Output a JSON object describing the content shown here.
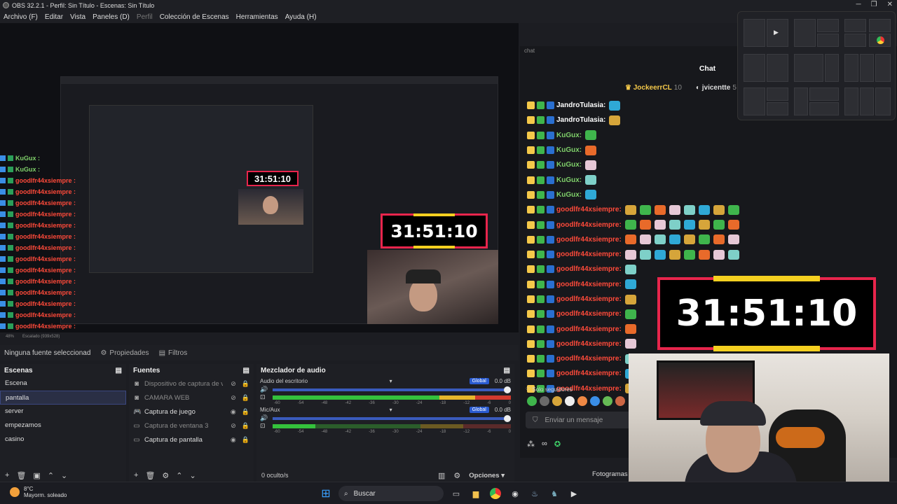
{
  "window": {
    "title": "OBS 32.2.1 - Perfil: Sin Título - Escenas: Sin Título"
  },
  "menu": [
    {
      "label": "Archivo (F)",
      "dim": false
    },
    {
      "label": "Editar",
      "dim": false
    },
    {
      "label": "Vista",
      "dim": false
    },
    {
      "label": "Paneles (D)",
      "dim": false
    },
    {
      "label": "Perfil",
      "dim": true
    },
    {
      "label": "Colección de Escenas",
      "dim": false
    },
    {
      "label": "Herramientas",
      "dim": false
    },
    {
      "label": "Ayuda (H)",
      "dim": false
    }
  ],
  "preview": {
    "timer_small": "31:51:10",
    "timer_mid": "31:51:10",
    "zoom": "48%",
    "scale_label": "Escalado (939x528)",
    "left_chat": [
      {
        "name": "KuGux :",
        "color": "g"
      },
      {
        "name": "KuGux :",
        "color": "g"
      },
      {
        "name": "goodlfr44xsiempre :",
        "color": "r"
      },
      {
        "name": "goodlfr44xsiempre :",
        "color": "r"
      },
      {
        "name": "goodlfr44xsiempre :",
        "color": "r"
      },
      {
        "name": "goodlfr44xsiempre :",
        "color": "r"
      },
      {
        "name": "goodlfr44xsiempre :",
        "color": "r"
      },
      {
        "name": "goodlfr44xsiempre :",
        "color": "r"
      },
      {
        "name": "goodlfr44xsiempre :",
        "color": "r"
      },
      {
        "name": "goodlfr44xsiempre :",
        "color": "r"
      },
      {
        "name": "goodlfr44xsiempre :",
        "color": "r"
      },
      {
        "name": "goodlfr44xsiempre :",
        "color": "r"
      },
      {
        "name": "goodlfr44xsiempre :",
        "color": "r"
      },
      {
        "name": "goodlfr44xsiempre :",
        "color": "r"
      },
      {
        "name": "goodlfr44xsiempre :",
        "color": "r"
      },
      {
        "name": "goodlfr44xsiempre :",
        "color": "r"
      }
    ]
  },
  "source_bar": {
    "no_source": "Ninguna fuente seleccionad",
    "props": "Propiedades",
    "filters": "Filtros"
  },
  "scenes": {
    "title": "Escenas",
    "items": [
      "Escena",
      "pantalla",
      "server",
      "empezamos",
      "casino"
    ],
    "selected_index": 1
  },
  "sources": {
    "title": "Fuentes",
    "items": [
      {
        "label": "Dispositivo de captura de vi",
        "dim": true,
        "icon": "camera-icon"
      },
      {
        "label": "CAMARA WEB",
        "dim": true,
        "icon": "camera-icon"
      },
      {
        "label": "Captura de juego",
        "dim": false,
        "icon": "gamepad-icon"
      },
      {
        "label": "Captura de ventana 3",
        "dim": true,
        "icon": "window-icon"
      },
      {
        "label": "Captura de pantalla",
        "dim": false,
        "icon": "monitor-icon"
      }
    ]
  },
  "mixer": {
    "title": "Mezclador de audio",
    "channels": [
      {
        "name": "Audio del escritorio",
        "global": "Global",
        "db": "0.0 dB",
        "level": "high"
      },
      {
        "name": "Mic/Aux",
        "global": "Global",
        "db": "0.0 dB",
        "level": "low"
      }
    ],
    "scale": [
      "-60",
      "-54",
      "-48",
      "-42",
      "-36",
      "-30",
      "-24",
      "-18",
      "-12",
      "-6",
      "0"
    ],
    "hidden": "0 oculto/s",
    "options": "Opciones"
  },
  "chat": {
    "label": "chat",
    "title": "Chat",
    "top_chatters": [
      {
        "name": "JockeerrCL",
        "count": "10"
      },
      {
        "name": "jvicentte",
        "count": "5"
      }
    ],
    "messages": [
      {
        "name": "JandroTulasia:",
        "color": "#ffffff"
      },
      {
        "name": "JandroTulasia:",
        "color": "#ffffff"
      },
      {
        "name": "KuGux:",
        "color": "#7fd06a"
      },
      {
        "name": "KuGux:",
        "color": "#7fd06a"
      },
      {
        "name": "KuGux:",
        "color": "#7fd06a"
      },
      {
        "name": "KuGux:",
        "color": "#7fd06a"
      },
      {
        "name": "KuGux:",
        "color": "#7fd06a"
      },
      {
        "name": "goodlfr44xsiempre:",
        "color": "#ff4a3a"
      },
      {
        "name": "goodlfr44xsiempre:",
        "color": "#ff4a3a"
      },
      {
        "name": "goodlfr44xsiempre:",
        "color": "#ff4a3a"
      },
      {
        "name": "goodlfr44xsiempre:",
        "color": "#ff4a3a"
      },
      {
        "name": "goodlfr44xsiempre:",
        "color": "#ff4a3a"
      },
      {
        "name": "goodlfr44xsiempre:",
        "color": "#ff4a3a"
      },
      {
        "name": "goodlfr44xsiempre:",
        "color": "#ff4a3a"
      },
      {
        "name": "goodlfr44xsiempre:",
        "color": "#ff4a3a"
      },
      {
        "name": "goodlfr44xsiempre:",
        "color": "#ff4a3a"
      },
      {
        "name": "goodlfr44xsiempre:",
        "color": "#ff4a3a"
      },
      {
        "name": "goodlfr44xsiempre:",
        "color": "#ff4a3a"
      },
      {
        "name": "goodlfr44xsiempre:",
        "color": "#ff4a3a"
      },
      {
        "name": "goodlfr44xsiempre:",
        "color": "#ff4a3a"
      }
    ],
    "followers_only": "Solo seguidores",
    "send_placeholder": "Enviar un mensaje"
  },
  "overlay": {
    "timer": "31:51:10"
  },
  "status": {
    "frames": "Fotogramas"
  },
  "taskbar": {
    "temp": "8°C",
    "weather": "Mayorm. soleado",
    "search": "Buscar"
  }
}
